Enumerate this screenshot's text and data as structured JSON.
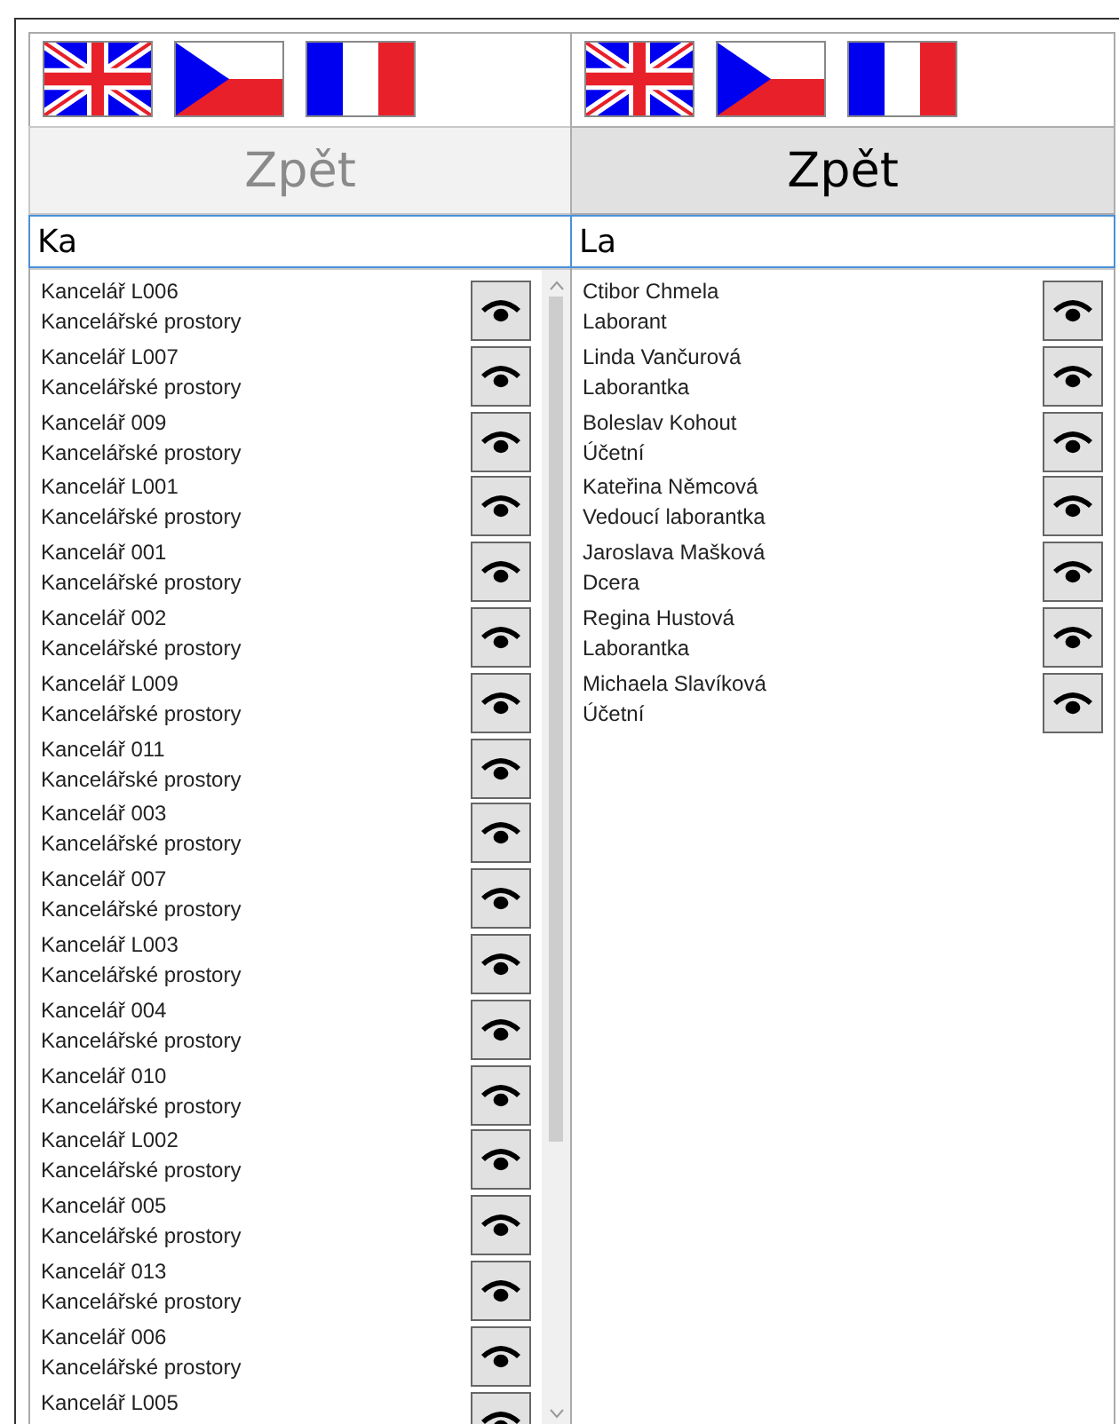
{
  "panes": [
    {
      "flags": [
        {
          "kind": "uk"
        },
        {
          "kind": "cz"
        },
        {
          "kind": "fr"
        }
      ],
      "back_button": {
        "label": "Zpět",
        "disabled": true
      },
      "search": {
        "value": "Ka"
      },
      "items": [
        {
          "name": "Kancelář L006",
          "subtitle": "Kancelářské prostory"
        },
        {
          "name": "Kancelář L007",
          "subtitle": "Kancelářské prostory"
        },
        {
          "name": "Kancelář 009",
          "subtitle": "Kancelářské prostory"
        },
        {
          "name": "Kancelář L001",
          "subtitle": "Kancelářské prostory"
        },
        {
          "name": "Kancelář 001",
          "subtitle": "Kancelářské prostory"
        },
        {
          "name": "Kancelář 002",
          "subtitle": "Kancelářské prostory"
        },
        {
          "name": "Kancelář L009",
          "subtitle": "Kancelářské prostory"
        },
        {
          "name": "Kancelář 011",
          "subtitle": "Kancelářské prostory"
        },
        {
          "name": "Kancelář 003",
          "subtitle": "Kancelářské prostory"
        },
        {
          "name": "Kancelář 007",
          "subtitle": "Kancelářské prostory"
        },
        {
          "name": "Kancelář L003",
          "subtitle": "Kancelářské prostory"
        },
        {
          "name": "Kancelář 004",
          "subtitle": "Kancelářské prostory"
        },
        {
          "name": "Kancelář 010",
          "subtitle": "Kancelářské prostory"
        },
        {
          "name": "Kancelář L002",
          "subtitle": "Kancelářské prostory"
        },
        {
          "name": "Kancelář 005",
          "subtitle": "Kancelářské prostory"
        },
        {
          "name": "Kancelář 013",
          "subtitle": "Kancelářské prostory"
        },
        {
          "name": "Kancelář 006",
          "subtitle": "Kancelářské prostory"
        },
        {
          "name": "Kancelář L005"
        }
      ]
    },
    {
      "flags": [
        {
          "kind": "uk"
        },
        {
          "kind": "cz"
        },
        {
          "kind": "fr"
        }
      ],
      "back_button": {
        "label": "Zpět",
        "disabled": false
      },
      "search": {
        "value": "La"
      },
      "items": [
        {
          "name": "Ctibor Chmela",
          "subtitle": "Laborant"
        },
        {
          "name": "Linda Vančurová",
          "subtitle": "Laborantka"
        },
        {
          "name": "Boleslav Kohout",
          "subtitle": "Účetní"
        },
        {
          "name": "Kateřina Němcová",
          "subtitle": "Vedoucí laborantka"
        },
        {
          "name": "Jaroslava Mašková",
          "subtitle": "Dcera"
        },
        {
          "name": "Regina Hustová",
          "subtitle": "Laborantka"
        },
        {
          "name": "Michaela Slavíková",
          "subtitle": "Účetní"
        }
      ]
    }
  ]
}
